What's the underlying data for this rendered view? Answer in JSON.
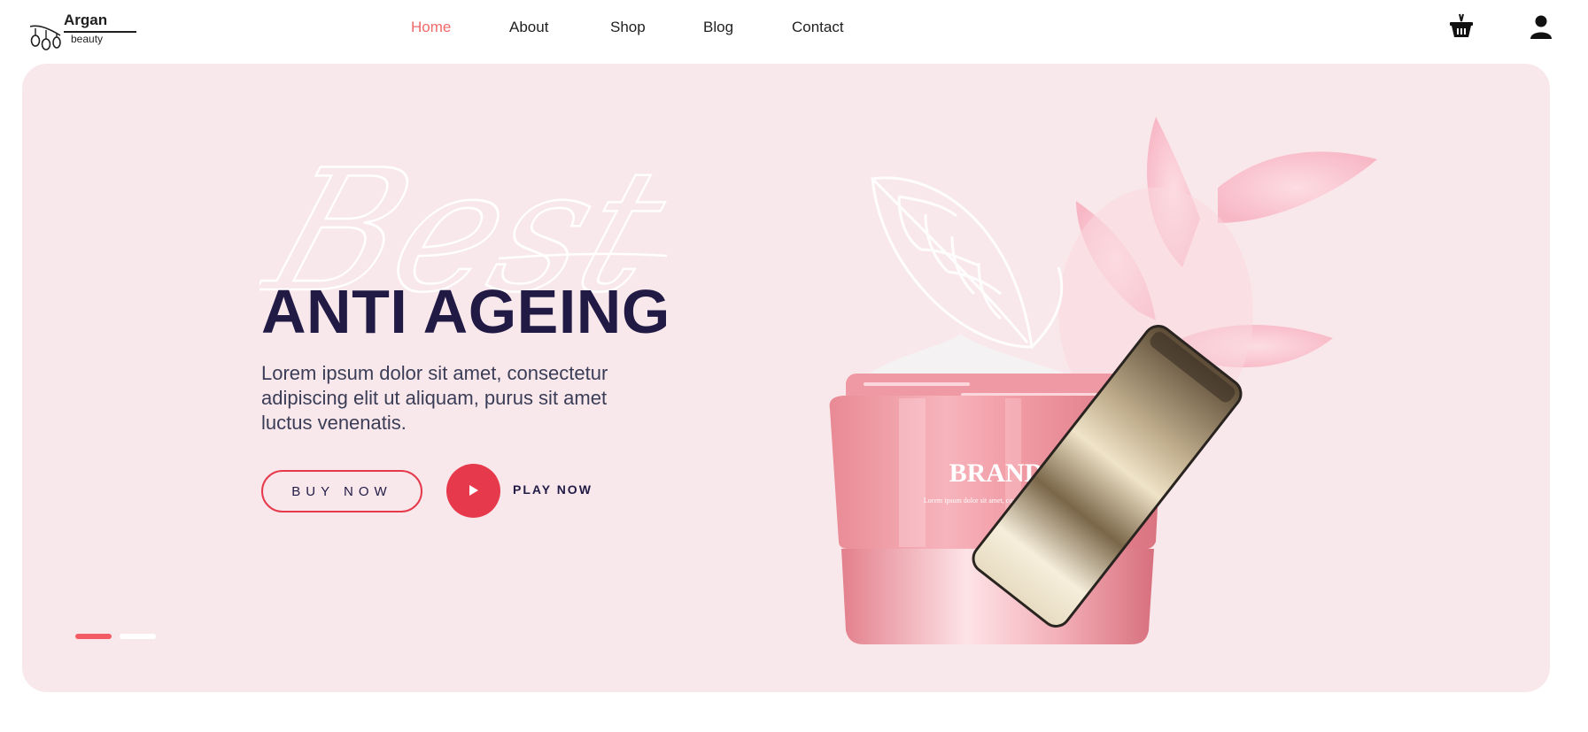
{
  "logo": {
    "name": "Argan",
    "subtitle": "beauty"
  },
  "nav": {
    "items": [
      {
        "label": "Home",
        "active": true
      },
      {
        "label": "About",
        "active": false
      },
      {
        "label": "Shop",
        "active": false
      },
      {
        "label": "Blog",
        "active": false
      },
      {
        "label": "Contact",
        "active": false
      }
    ]
  },
  "header_icons": [
    "basket-icon",
    "user-icon"
  ],
  "hero": {
    "script_word": "Best",
    "title": "ANTI AGEING",
    "description": "Lorem ipsum dolor sit amet, consectetur adipiscing elit ut aliquam, purus sit amet luctus venenatis.",
    "buy_label": "BUY NOW",
    "play_label": "PLAY NOW",
    "slides": {
      "count": 2,
      "active": 1
    },
    "product": {
      "brand": "BRAND",
      "tagline": "Lorem ipsum dolor sit amet, consectetur adipiscing"
    }
  },
  "colors": {
    "accent": "#e63a4c",
    "nav_active": "#f06a6a",
    "hero_bg": "#f9e8eb",
    "heading": "#201a45"
  }
}
